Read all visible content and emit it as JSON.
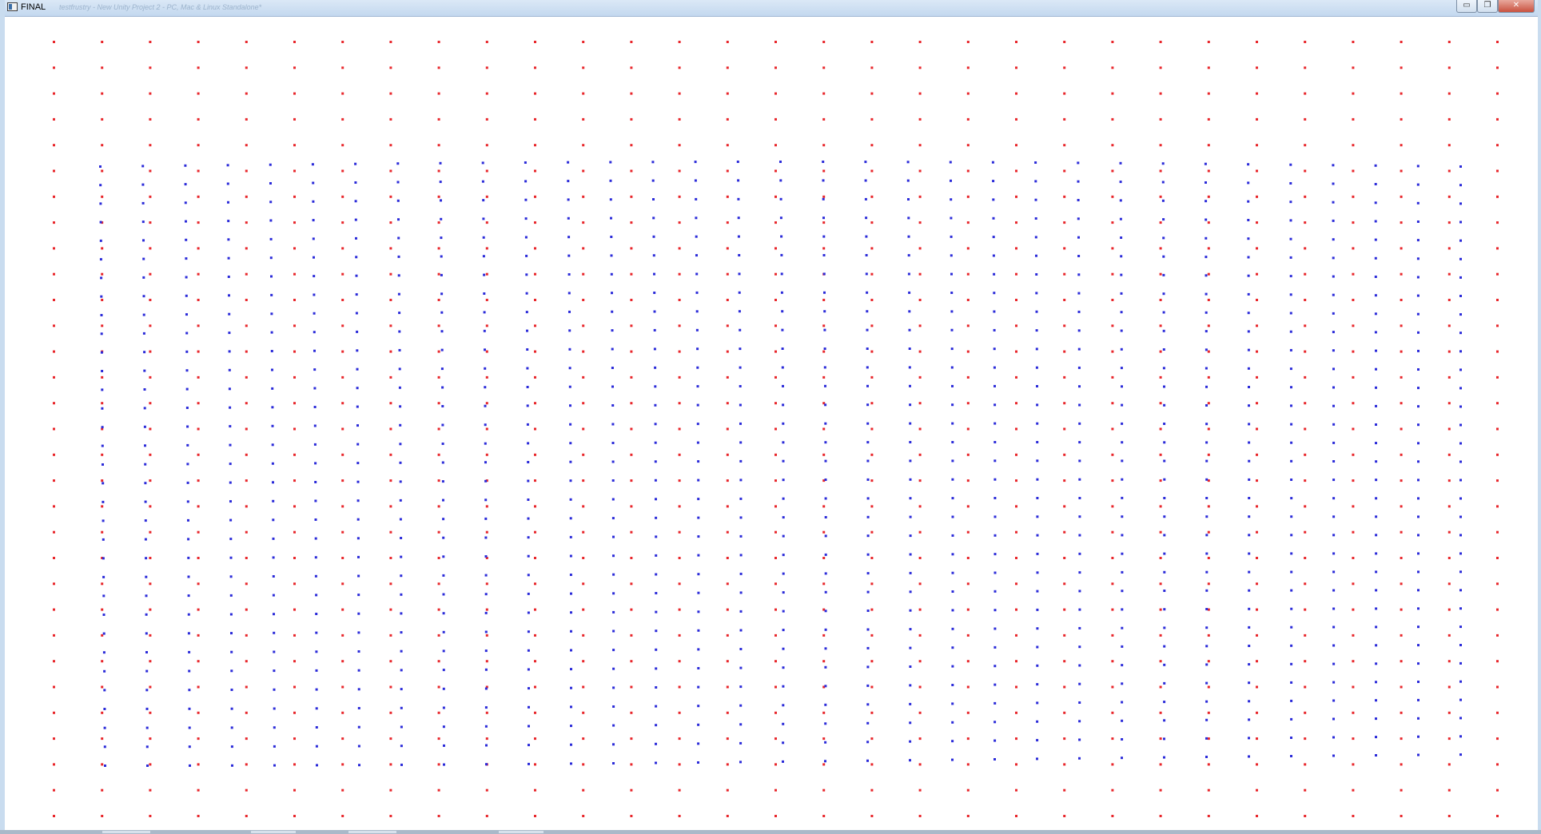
{
  "window": {
    "title": "FINAL",
    "subtitle": "testfrustry - New Unity Project 2 - PC, Mac & Linux Standalone*",
    "controls": {
      "minimize": "▭",
      "maximize": "❐",
      "close": "✕"
    }
  },
  "canvas": {
    "background": "#ffffff",
    "reference_grid": {
      "color": "#e8262b",
      "columns": 31,
      "rows": 32
    },
    "deformed_grid": {
      "color": "#2b2bd9",
      "columns": 33,
      "rows": 33
    }
  },
  "icons": [
    "app-icon",
    "minimize-icon",
    "maximize-icon",
    "close-icon"
  ]
}
